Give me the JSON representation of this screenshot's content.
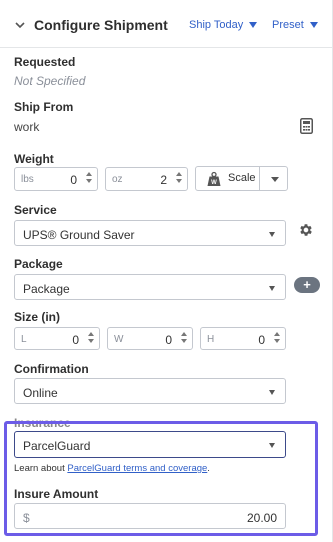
{
  "header": {
    "title": "Configure Shipment",
    "ship_date": "Ship Today",
    "preset": "Preset"
  },
  "requested": {
    "label": "Requested",
    "value": "Not Specified"
  },
  "ship_from": {
    "label": "Ship From",
    "value": "work",
    "icon": "calculator-icon"
  },
  "weight": {
    "label": "Weight",
    "lbs": {
      "unit": "lbs",
      "value": "0"
    },
    "oz": {
      "unit": "oz",
      "value": "2"
    },
    "scale_label": "Scale"
  },
  "service": {
    "label": "Service",
    "value": "UPS® Ground Saver",
    "icon": "gear-icon"
  },
  "package": {
    "label": "Package",
    "value": "Package",
    "add": "+"
  },
  "size": {
    "label": "Size (in)",
    "l": {
      "unit": "L",
      "value": "0"
    },
    "w": {
      "unit": "W",
      "value": "0"
    },
    "h": {
      "unit": "H",
      "value": "0"
    }
  },
  "confirmation": {
    "label": "Confirmation",
    "value": "Online"
  },
  "insurance": {
    "label": "Insurance",
    "value": "ParcelGuard",
    "learn_prefix": "Learn about ",
    "learn_link": "ParcelGuard terms and coverage",
    "learn_suffix": "."
  },
  "insure_amount": {
    "label": "Insure Amount",
    "currency": "$",
    "value": "20.00"
  },
  "colors": {
    "accent": "#3160c8",
    "focus": "#6c5ce7"
  }
}
